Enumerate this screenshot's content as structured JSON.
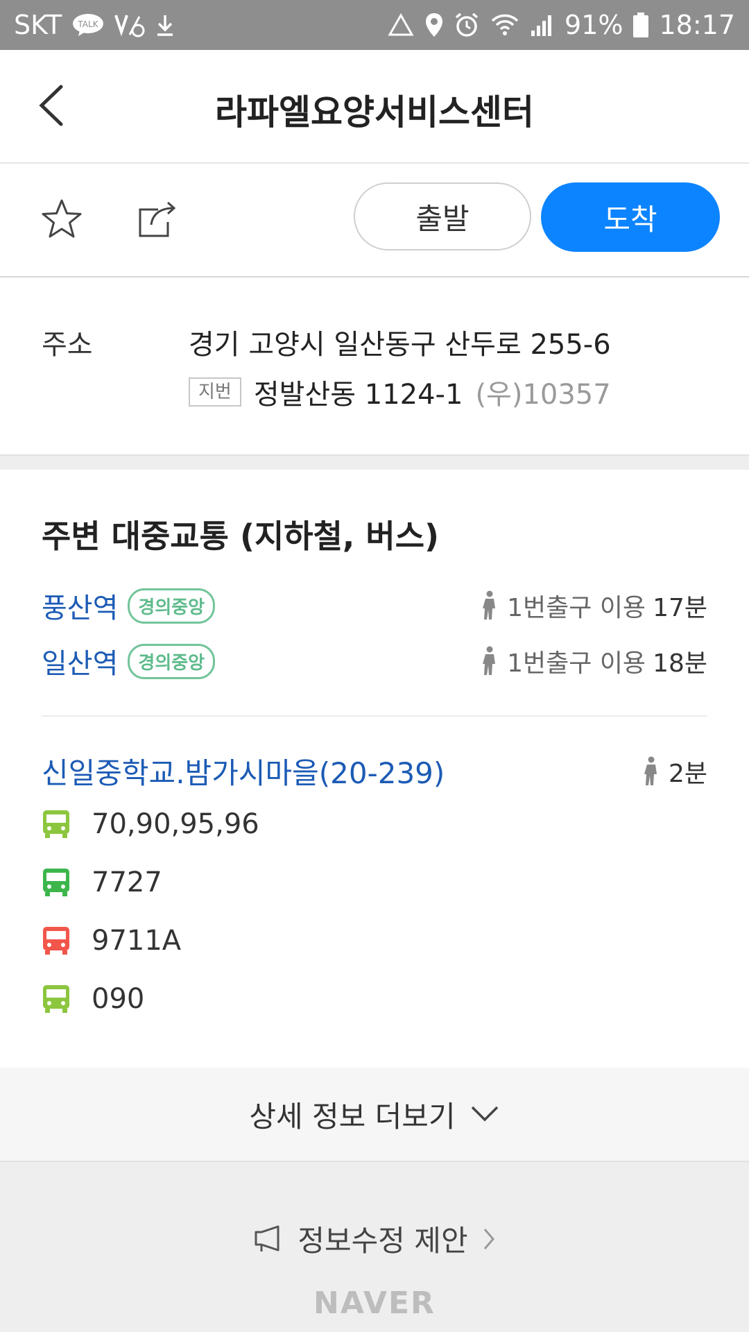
{
  "status_bar": {
    "carrier": "SKT",
    "talk_label": "TALK",
    "battery": "91%",
    "time": "18:17"
  },
  "header": {
    "title": "라파엘요양서비스센터"
  },
  "actions": {
    "depart_label": "출발",
    "arrive_label": "도착"
  },
  "address": {
    "label": "주소",
    "road": "경기 고양시 일산동구 산두로 255-6",
    "jibun_badge": "지번",
    "lot": "정발산동 1124-1",
    "postal": "(우)10357"
  },
  "transit": {
    "title": "주변 대중교통 (지하철, 버스)",
    "stations": [
      {
        "name": "풍산역",
        "line": "경의중앙",
        "walk_prefix": "1번출구 이용",
        "walk_time": "17분"
      },
      {
        "name": "일산역",
        "line": "경의중앙",
        "walk_prefix": "1번출구 이용",
        "walk_time": "18분"
      }
    ],
    "bus_stop": {
      "name": "신일중학교.밤가시마을(20-239)",
      "walk_time": "2분",
      "routes": [
        {
          "number": "70,90,95,96",
          "color": "#8cc63f"
        },
        {
          "number": "7727",
          "color": "#3cb64b"
        },
        {
          "number": "9711A",
          "color": "#f2564b"
        },
        {
          "number": "090",
          "color": "#8cc63f"
        }
      ]
    }
  },
  "more_label": "상세 정보 더보기",
  "footer": {
    "suggest_label": "정보수정 제안",
    "brand": "NAVER"
  },
  "colors": {
    "accent": "#0d84ff",
    "link": "#1c5bb5",
    "line_badge": "#5fbb8c"
  }
}
